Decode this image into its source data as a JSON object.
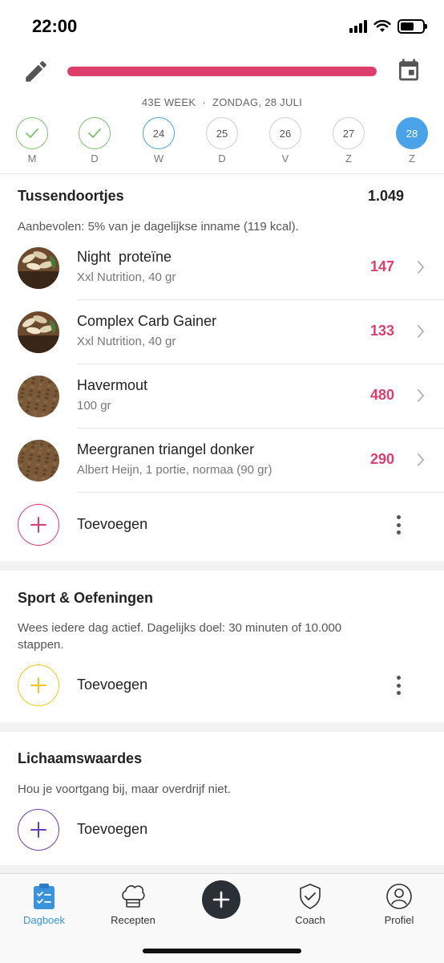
{
  "status": {
    "time": "22:00"
  },
  "header": {
    "progress_fraction": 1.0,
    "accent": "#dc3f6b"
  },
  "week": {
    "label": "43E WEEK",
    "separator": "·",
    "date": "ZONDAG, 28 JULI"
  },
  "days": [
    {
      "letter": "M",
      "number": "",
      "state": "done"
    },
    {
      "letter": "D",
      "number": "",
      "state": "done"
    },
    {
      "letter": "W",
      "number": "24",
      "state": "today-ring"
    },
    {
      "letter": "D",
      "number": "25",
      "state": "normal"
    },
    {
      "letter": "V",
      "number": "26",
      "state": "normal"
    },
    {
      "letter": "Z",
      "number": "27",
      "state": "normal"
    },
    {
      "letter": "Z",
      "number": "28",
      "state": "selected"
    }
  ],
  "snacks": {
    "title": "Tussendoortjes",
    "total": "1.049",
    "description": "Aanbevolen: 5% van je dagelijkse inname (119 kcal).",
    "items": [
      {
        "name": "Night  proteïne",
        "sub": "Xxl Nutrition, 40 gr",
        "kcal": "147",
        "thumb": "capsules"
      },
      {
        "name": "Complex Carb Gainer",
        "sub": "Xxl Nutrition, 40 gr",
        "kcal": "133",
        "thumb": "capsules"
      },
      {
        "name": "Havermout",
        "sub": "100 gr",
        "kcal": "480",
        "thumb": "grains"
      },
      {
        "name": "Meergranen triangel donker",
        "sub": "Albert Heijn, 1 portie, normaa (90 gr)",
        "kcal": "290",
        "thumb": "grains"
      }
    ],
    "add_label": "Toevoegen",
    "add_color": "#dc3f6b"
  },
  "sport": {
    "title": "Sport & Oefeningen",
    "description": "Wees iedere dag actief. Dagelijks doel: 30 minuten of 10.000 stappen.",
    "add_label": "Toevoegen",
    "add_color": "#f2c81e"
  },
  "body": {
    "title": "Lichaamswaardes",
    "description": "Hou je voortgang bij, maar overdrijf niet.",
    "add_label": "Toevoegen",
    "add_color": "#6a3fb5"
  },
  "tabbar": {
    "tabs": [
      {
        "label": "Dagboek",
        "icon": "clipboard-icon",
        "active": true
      },
      {
        "label": "Recepten",
        "icon": "chef-hat-icon",
        "active": false
      },
      {
        "label": "Coach",
        "icon": "shield-check-icon",
        "active": false
      },
      {
        "label": "Profiel",
        "icon": "profile-icon",
        "active": false
      }
    ],
    "active_color": "#3b93dc"
  }
}
